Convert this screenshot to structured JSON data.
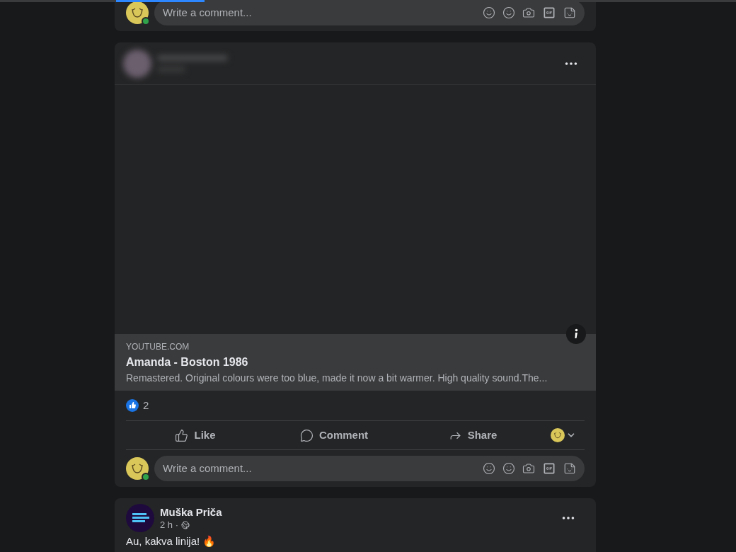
{
  "posts": [
    {
      "kind": "comment_only",
      "comment_box": {
        "placeholder": "Write a comment..."
      }
    },
    {
      "kind": "link",
      "link": {
        "domain": "YOUTUBE.COM",
        "title": "Amanda - Boston 1986",
        "description": "Remastered. Original colours were too blue, made it now a bit warmer. High quality sound.The..."
      },
      "reactions": {
        "count": "2"
      },
      "actions": [
        {
          "kind": "like",
          "label": "Like"
        },
        {
          "kind": "comment",
          "label": "Comment"
        },
        {
          "kind": "share",
          "label": "Share"
        }
      ],
      "comment_box": {
        "placeholder": "Write a comment..."
      }
    },
    {
      "kind": "text",
      "author": "Muška Priča",
      "time": "2 h ·",
      "text": "Au, kakva linija! 🔥"
    }
  ]
}
